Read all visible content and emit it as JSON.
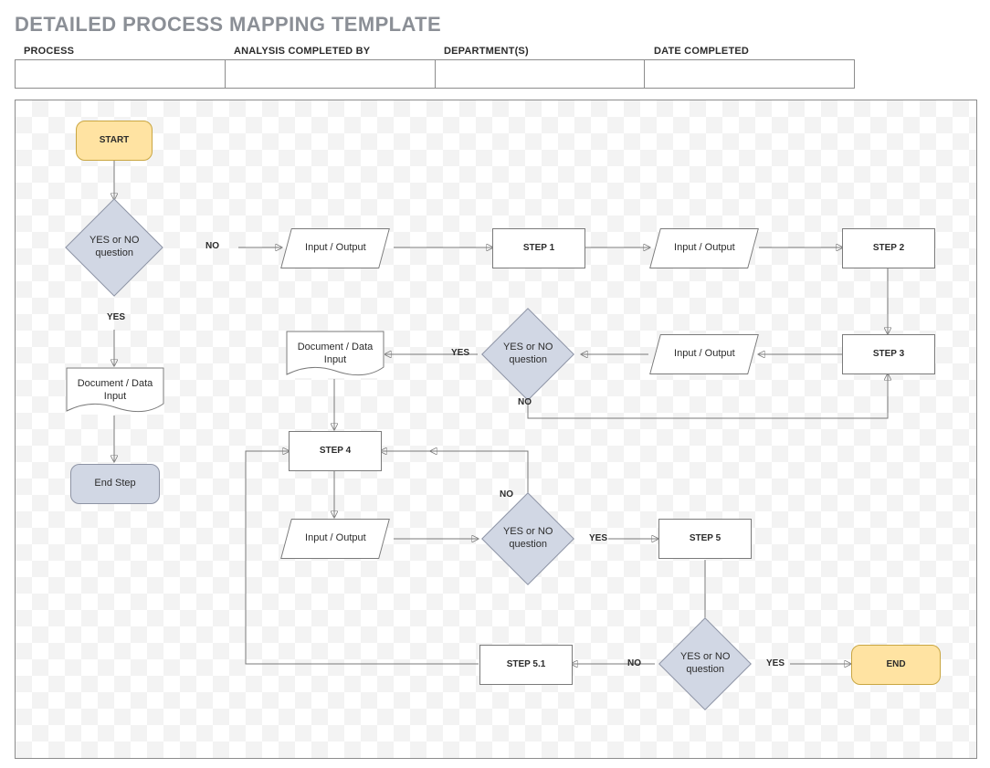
{
  "title": "DETAILED PROCESS MAPPING TEMPLATE",
  "headers": {
    "process": "PROCESS",
    "analysis": "ANALYSIS COMPLETED BY",
    "department": "DEPARTMENT(S)",
    "date": "DATE COMPLETED"
  },
  "inputs": {
    "process": "",
    "analysis": "",
    "department": "",
    "date": ""
  },
  "nodes": {
    "start": "START",
    "q1": "YES or NO question",
    "q1_yes": "YES",
    "q1_no": "NO",
    "io1": "Input / Output",
    "step1": "STEP 1",
    "io2": "Input / Output",
    "step2": "STEP 2",
    "step3": "STEP 3",
    "io3": "Input / Output",
    "q2": "YES or NO question",
    "q2_yes": "YES",
    "q2_no": "NO",
    "doc1": "Document / Data Input",
    "endstep": "End Step",
    "doc2": "Document / Data Input",
    "step4": "STEP 4",
    "io4": "Input / Output",
    "q3": "YES or NO question",
    "q3_yes": "YES",
    "q3_no": "NO",
    "step5": "STEP 5",
    "q4": "YES or NO question",
    "q4_yes": "YES",
    "q4_no": "NO",
    "step51": "STEP 5.1",
    "end": "END"
  }
}
